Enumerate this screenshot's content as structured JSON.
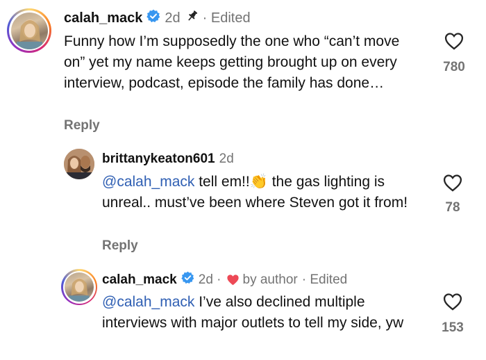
{
  "comments": [
    {
      "username": "calah_mack",
      "time": "2d",
      "edited": "· Edited",
      "text": "Funny how I’m supposedly the one who “can’t move on” yet my name keeps getting brought up on every interview, podcast, episode the family has done…",
      "reply_label": "Reply",
      "likes": "780"
    },
    {
      "username": "brittanykeaton601",
      "time": "2d",
      "mention": "@calah_mack",
      "text_before_emoji": " tell em!!",
      "emoji": "👏",
      "text_after_emoji": " the gas lighting is unreal.. must’ve been where Steven got it from!",
      "reply_label": "Reply",
      "likes": "78"
    },
    {
      "username": "calah_mack",
      "time": "2d ·",
      "liked_by": "by author",
      "edited": "· Edited",
      "mention": "@calah_mack",
      "text": " I’ve also declined multiple interviews with major outlets to tell my side, yw",
      "likes": "153"
    }
  ],
  "colors": {
    "mention": "#2f5fb3",
    "verified": "#3897f0",
    "heart": "#ed4956",
    "secondary": "#737373"
  }
}
